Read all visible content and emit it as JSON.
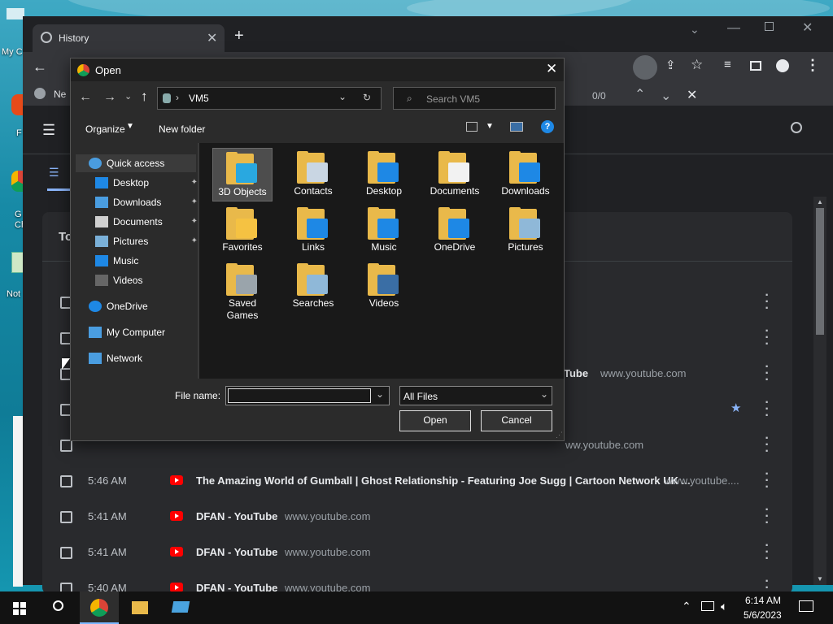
{
  "desktop": {
    "icons": [
      "My C",
      "F",
      "G\nCh",
      "Not"
    ]
  },
  "chrome": {
    "tab_title": "History",
    "new_tab_symbol": "+",
    "bookmark_label": "Ne",
    "find": {
      "count": "0/0"
    },
    "history_heading": "To",
    "rows": [
      {
        "time": "",
        "title": "",
        "domain": "",
        "starred": false
      },
      {
        "time": "",
        "title": "",
        "domain": "",
        "starred": false
      },
      {
        "time": "",
        "title": "Tube",
        "domain": "www.youtube.com",
        "starred": false
      },
      {
        "time": "",
        "title": "",
        "domain": "",
        "starred": true
      },
      {
        "time": "",
        "title": "",
        "domain": "ww.youtube.com",
        "starred": false
      },
      {
        "time": "5:46 AM",
        "title": "The Amazing World of Gumball | Ghost Relationship - Featuring Joe Sugg | Cartoon Network UK ...",
        "domain": "www.youtube....",
        "starred": false
      },
      {
        "time": "5:41 AM",
        "title": "DFAN - YouTube",
        "domain": "www.youtube.com",
        "starred": false
      },
      {
        "time": "5:41 AM",
        "title": "DFAN - YouTube",
        "domain": "www.youtube.com",
        "starred": false
      },
      {
        "time": "5:40 AM",
        "title": "DFAN - YouTube",
        "domain": "www.youtube.com",
        "starred": false
      }
    ]
  },
  "dialog": {
    "title": "Open",
    "path": [
      "VM5"
    ],
    "search_placeholder": "Search VM5",
    "organize": "Organize",
    "new_folder": "New folder",
    "nav": [
      {
        "label": "Quick access",
        "icon": "star-icon",
        "pinned": false
      },
      {
        "label": "Desktop",
        "icon": "desktop-icon",
        "pinned": true
      },
      {
        "label": "Downloads",
        "icon": "download-icon",
        "pinned": true
      },
      {
        "label": "Documents",
        "icon": "document-icon",
        "pinned": true
      },
      {
        "label": "Pictures",
        "icon": "picture-icon",
        "pinned": true
      },
      {
        "label": "Music",
        "icon": "music-icon",
        "pinned": false
      },
      {
        "label": "Videos",
        "icon": "video-icon",
        "pinned": false
      },
      {
        "label": "OneDrive",
        "icon": "cloud-icon",
        "pinned": false
      },
      {
        "label": "My Computer",
        "icon": "computer-icon",
        "pinned": false
      },
      {
        "label": "Network",
        "icon": "network-icon",
        "pinned": false
      }
    ],
    "folders": [
      {
        "label": "3D Objects",
        "overlay": "3d-cube",
        "color": "#29a8e0"
      },
      {
        "label": "Contacts",
        "overlay": "contact-card",
        "color": "#c9d6e3"
      },
      {
        "label": "Desktop",
        "overlay": "desktop-screen",
        "color": "#1e88e5"
      },
      {
        "label": "Documents",
        "overlay": "document-page",
        "color": "#f2f2f2"
      },
      {
        "label": "Downloads",
        "overlay": "down-arrow",
        "color": "#1e88e5"
      },
      {
        "label": "Favorites",
        "overlay": "star",
        "color": "#f5c242"
      },
      {
        "label": "Links",
        "overlay": "link-arrow",
        "color": "#1e88e5"
      },
      {
        "label": "Music",
        "overlay": "music-note",
        "color": "#1e88e5"
      },
      {
        "label": "OneDrive",
        "overlay": "cloud",
        "color": "#1e88e5"
      },
      {
        "label": "Pictures",
        "overlay": "landscape",
        "color": "#8fb8d8"
      },
      {
        "label": "Saved\nGames",
        "overlay": "chess-piece",
        "color": "#9aa4ab"
      },
      {
        "label": "Searches",
        "overlay": "magnifier",
        "color": "#8fb8d8"
      },
      {
        "label": "Videos",
        "overlay": "film-strip",
        "color": "#3a6ea5"
      }
    ],
    "file_name_label": "File name:",
    "file_name_value": "",
    "filter": "All Files",
    "open_button": "Open",
    "cancel_button": "Cancel"
  },
  "taskbar": {
    "time": "6:14 AM",
    "date": "5/6/2023"
  }
}
